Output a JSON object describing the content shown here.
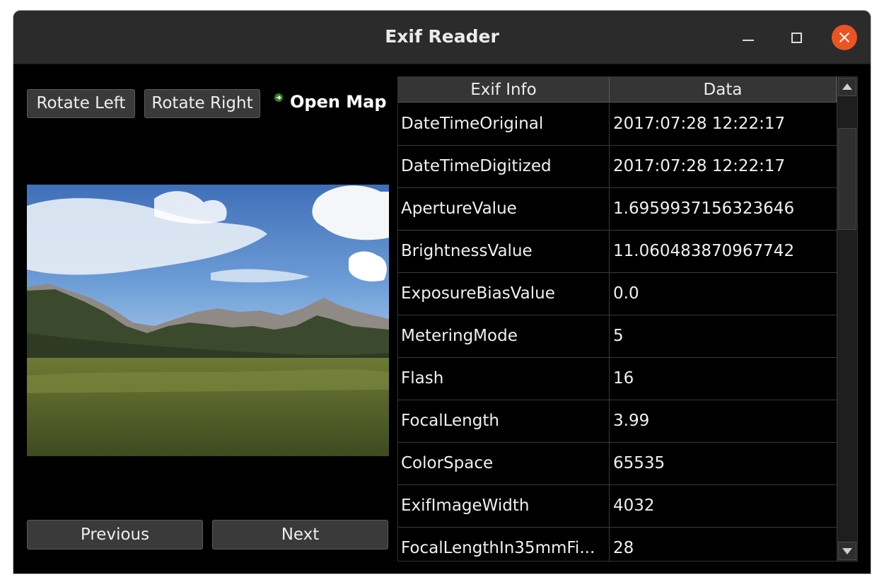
{
  "window": {
    "title": "Exif Reader",
    "controls": {
      "minimize": "minimize-icon",
      "maximize": "maximize-icon",
      "close": "close-icon"
    },
    "close_color": "#e95420"
  },
  "toolbar": {
    "rotate_left": "Rotate Left",
    "rotate_right": "Rotate Right",
    "open_map": "Open Map",
    "open_map_icon": "green-arrow-icon"
  },
  "navigation": {
    "previous": "Previous",
    "next": "Next"
  },
  "table": {
    "headers": [
      "Exif Info",
      "Data"
    ],
    "rows": [
      {
        "key": "DateTimeOriginal",
        "value": "2017:07:28 12:22:17"
      },
      {
        "key": "DateTimeDigitized",
        "value": "2017:07:28 12:22:17"
      },
      {
        "key": "ApertureValue",
        "value": "1.6959937156323646"
      },
      {
        "key": "BrightnessValue",
        "value": "11.060483870967742"
      },
      {
        "key": "ExposureBiasValue",
        "value": "0.0"
      },
      {
        "key": "MeteringMode",
        "value": "5"
      },
      {
        "key": "Flash",
        "value": "16"
      },
      {
        "key": "FocalLength",
        "value": "3.99"
      },
      {
        "key": "ColorSpace",
        "value": "65535"
      },
      {
        "key": "ExifImageWidth",
        "value": "4032"
      },
      {
        "key": "FocalLengthIn35mmFi...",
        "value": "28"
      }
    ]
  }
}
